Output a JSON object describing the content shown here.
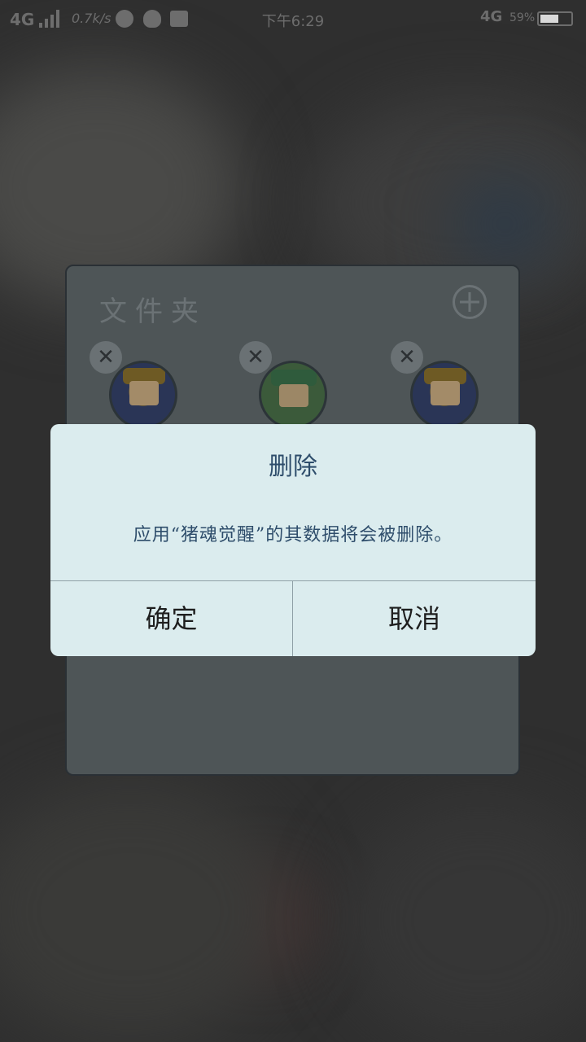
{
  "status_bar": {
    "network_left": "4G",
    "speed": "0.7k/s",
    "time": "下午6:29",
    "network_right": "4G",
    "battery": "59%",
    "icons": [
      "signal-icon",
      "app-notification-icon",
      "qq-icon",
      "mail-icon",
      "battery-icon"
    ]
  },
  "folder": {
    "title": "文件夹",
    "apps": [
      {
        "icon": "game-girl-icon",
        "remove_glyph": "✕"
      },
      {
        "icon": "game-boy-icon",
        "remove_glyph": "✕"
      },
      {
        "icon": "game-girl-icon",
        "remove_glyph": "✕"
      }
    ]
  },
  "dialog": {
    "title": "删除",
    "message": "应用“猪魂觉醒”的其数据将会被删除。",
    "confirm_label": "确定",
    "cancel_label": "取消"
  },
  "colors": {
    "dialog_bg": "#dbecee",
    "dialog_text": "#2e4d6b",
    "button_text": "#1e1e1e",
    "folder_bg": "#4e5557"
  }
}
